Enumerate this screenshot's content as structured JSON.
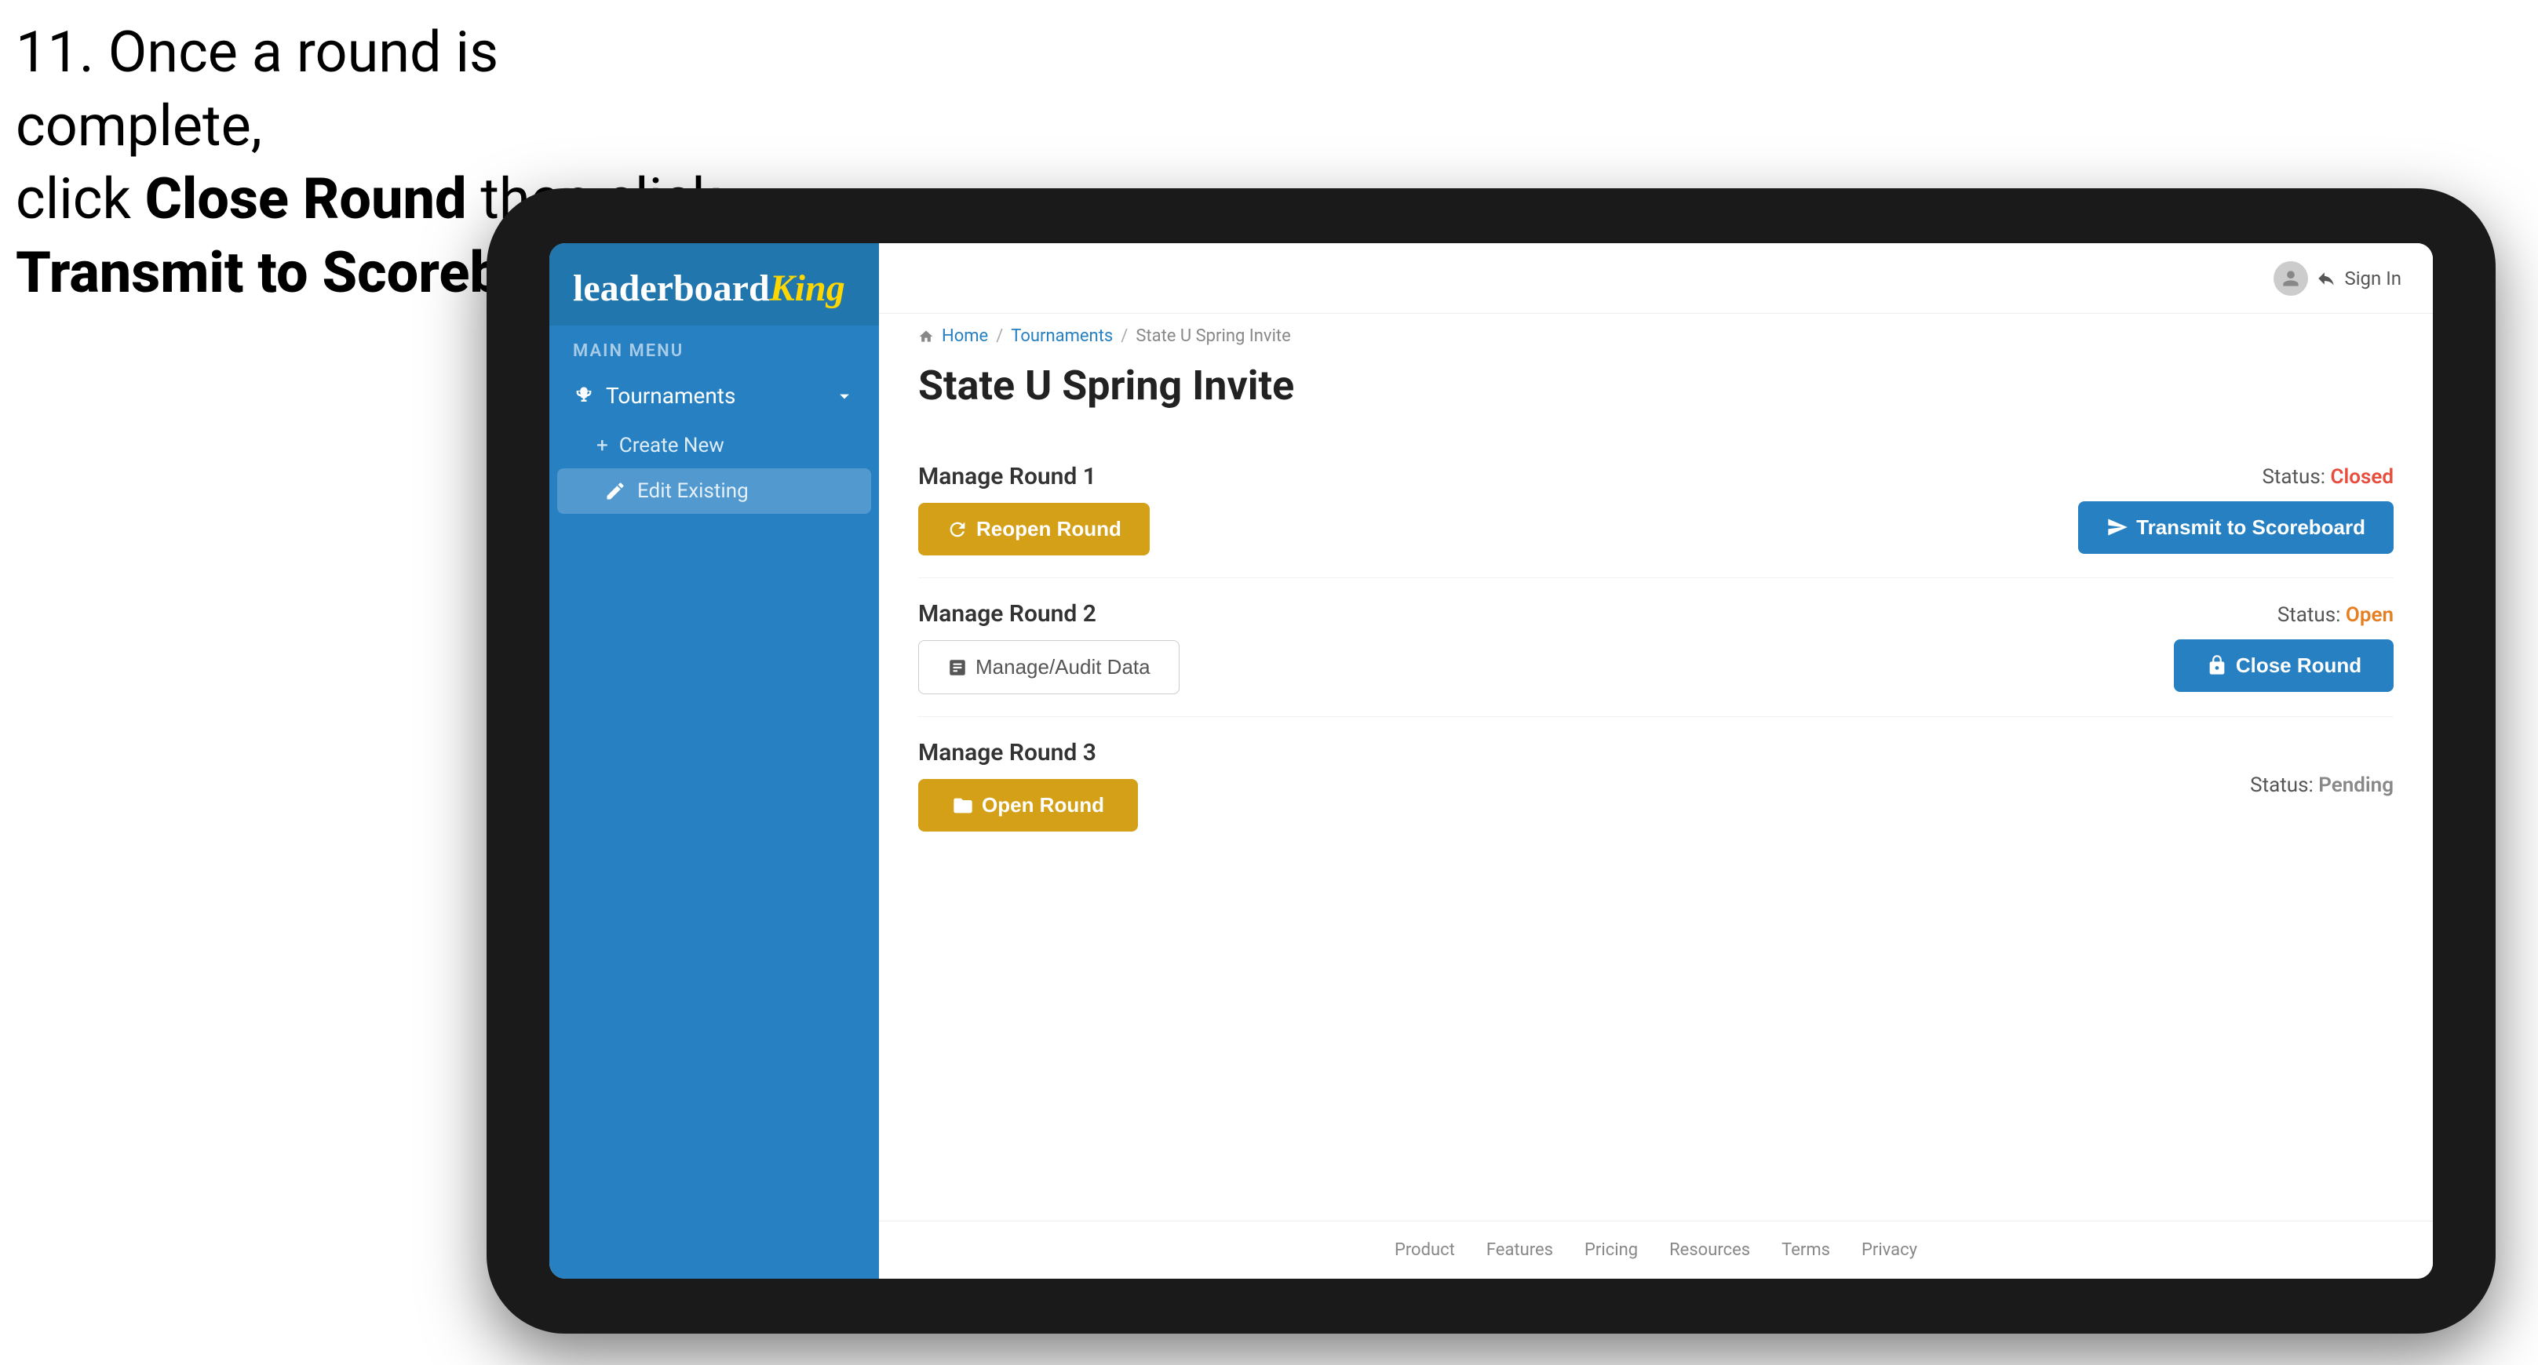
{
  "instruction": {
    "line1": "11. Once a round is complete,",
    "line2": "click ",
    "bold1": "Close Round",
    "line3": " then click",
    "bold2": "Transmit to Scoreboard."
  },
  "sidebar": {
    "logo_text": "leaderboard",
    "logo_king": "King",
    "main_menu_label": "MAIN MENU",
    "tournaments_label": "Tournaments",
    "create_new_label": "Create New",
    "edit_existing_label": "Edit Existing"
  },
  "topnav": {
    "sign_in": "Sign In"
  },
  "breadcrumb": {
    "home": "Home",
    "tournaments": "Tournaments",
    "current": "State U Spring Invite"
  },
  "page": {
    "title": "State U Spring Invite"
  },
  "rounds": [
    {
      "id": "round1",
      "title": "Manage Round 1",
      "status_label": "Status:",
      "status_value": "Closed",
      "status_class": "status-closed",
      "primary_btn": "Reopen Round",
      "primary_btn_style": "btn-gold",
      "secondary_btn": "Transmit to Scoreboard",
      "secondary_btn_style": "btn-blue",
      "has_audit": false
    },
    {
      "id": "round2",
      "title": "Manage Round 2",
      "status_label": "Status:",
      "status_value": "Open",
      "status_class": "status-open",
      "primary_btn": "Manage/Audit Data",
      "primary_btn_style": "btn-outline",
      "secondary_btn": "Close Round",
      "secondary_btn_style": "btn-blue",
      "has_audit": true
    },
    {
      "id": "round3",
      "title": "Manage Round 3",
      "status_label": "Status:",
      "status_value": "Pending",
      "status_class": "status-pending",
      "primary_btn": "Open Round",
      "primary_btn_style": "btn-gold",
      "secondary_btn": null,
      "has_audit": false
    }
  ],
  "footer": {
    "links": [
      "Product",
      "Features",
      "Pricing",
      "Resources",
      "Terms",
      "Privacy"
    ]
  },
  "colors": {
    "accent_blue": "#2680c2",
    "accent_gold": "#d4a017",
    "status_closed": "#e74c3c",
    "status_open": "#e67e22",
    "status_pending": "#888888"
  }
}
